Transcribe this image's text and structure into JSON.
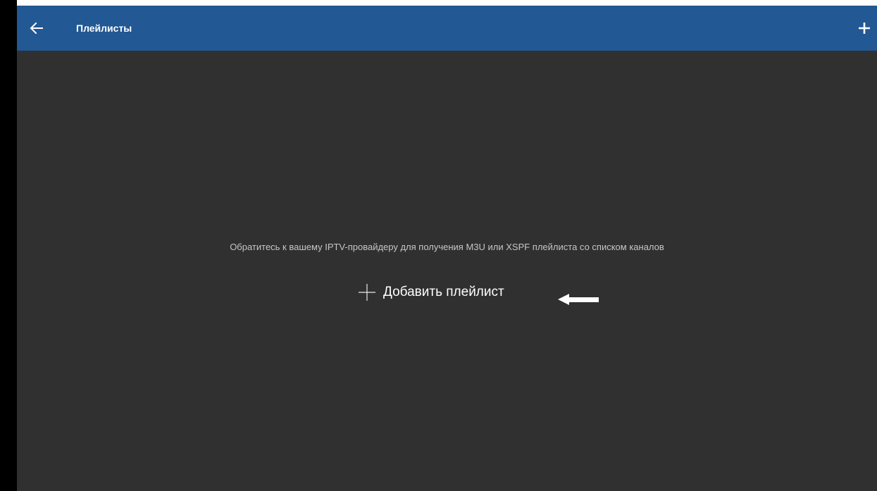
{
  "toolbar": {
    "title": "Плейлисты",
    "back_icon": "arrow-left-icon",
    "add_icon": "plus-icon",
    "background": "#225893"
  },
  "empty_state": {
    "hint": "Обратитесь к вашему IPTV-провайдеру для получения M3U или XSPF плейлиста со списком каналов",
    "add_label": "Добавить плейлист",
    "add_icon": "plus-icon",
    "pointer_icon": "arrow-left-icon"
  },
  "colors": {
    "background": "#303030",
    "text_primary": "#ffffff",
    "text_secondary": "#c6c6c6"
  }
}
